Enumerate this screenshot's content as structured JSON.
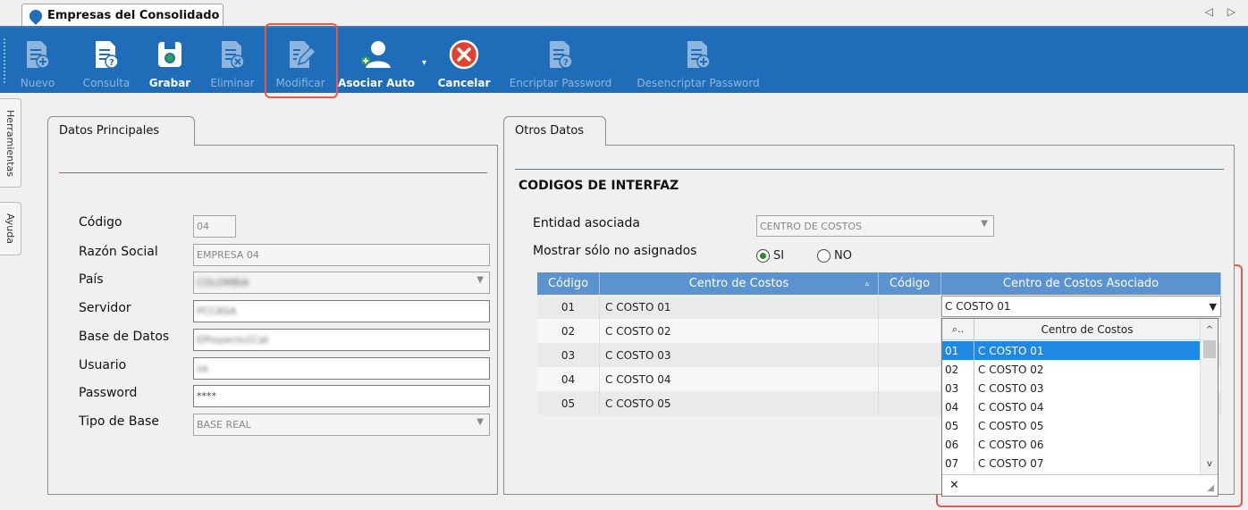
{
  "window": {
    "tab_title": "Empresas del Consolidado",
    "nav_arrows": "◁ ▷"
  },
  "toolbar": {
    "nuevo": "Nuevo",
    "consulta": "Consulta",
    "grabar": "Grabar",
    "eliminar": "Eliminar",
    "modificar": "Modificar",
    "asociar_auto": "Asociar Auto",
    "cancelar": "Cancelar",
    "encriptar": "Encriptar Password",
    "desencriptar": "Desencriptar Password"
  },
  "side_tabs": {
    "herramientas": "Herramientas",
    "ayuda": "Ayuda"
  },
  "datos_principales": {
    "tab_label": "Datos Principales",
    "codigo_label": "Código",
    "codigo_value": "04",
    "razon_label": "Razón Social",
    "razon_value": "EMPRESA 04",
    "pais_label": "País",
    "pais_value": "COLOMBIA",
    "servidor_label": "Servidor",
    "servidor_value": "PCCASA",
    "base_label": "Base de Datos",
    "base_value": "EProyecto1Cat",
    "usuario_label": "Usuario",
    "usuario_value": "sa",
    "password_label": "Password",
    "password_value": "****",
    "tipo_label": "Tipo de Base",
    "tipo_value": "BASE REAL"
  },
  "otros_datos": {
    "tab_label": "Otros Datos",
    "section_title": "CODIGOS DE INTERFAZ",
    "entidad_label": "Entidad asociada",
    "entidad_value": "CENTRO DE COSTOS",
    "mostrar_label": "Mostrar sólo no asignados",
    "radio_si": "SI",
    "radio_no": "NO",
    "grid": {
      "headers": [
        "Código",
        "Centro de Costos",
        "Código",
        "Centro de Costos Asociado"
      ],
      "rows": [
        [
          "01",
          "C COSTO 01"
        ],
        [
          "02",
          "C COSTO 02"
        ],
        [
          "03",
          "C COSTO 03"
        ],
        [
          "04",
          "C COSTO 04"
        ],
        [
          "05",
          "C COSTO 05"
        ]
      ]
    },
    "dropdown": {
      "selected": "C COSTO 01",
      "header_code": "..",
      "header_name": "Centro de Costos",
      "items": [
        [
          "01",
          "C COSTO 01"
        ],
        [
          "02",
          "C COSTO 02"
        ],
        [
          "03",
          "C COSTO 03"
        ],
        [
          "04",
          "C COSTO 04"
        ],
        [
          "05",
          "C COSTO 05"
        ],
        [
          "06",
          "C COSTO 06"
        ],
        [
          "07",
          "C COSTO 07"
        ]
      ]
    }
  },
  "colors": {
    "toolbar_bg": "#1f6db8",
    "grid_header": "#5b93cf",
    "highlight": "#e8574a",
    "selection": "#1e88e5"
  }
}
